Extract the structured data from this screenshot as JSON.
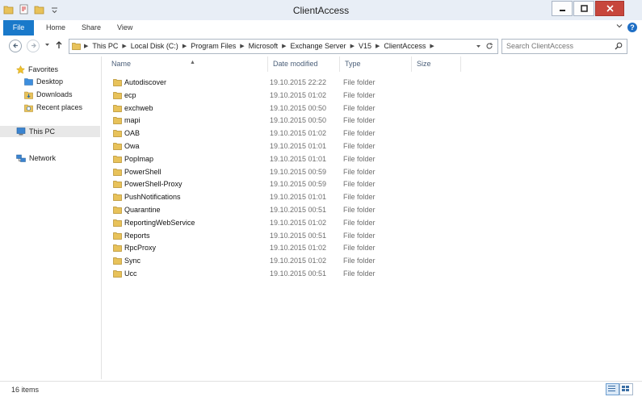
{
  "window": {
    "title": "ClientAccess"
  },
  "ribbon": {
    "tabs": [
      "File",
      "Home",
      "Share",
      "View"
    ],
    "help": "?"
  },
  "address": {
    "crumbs": [
      "This PC",
      "Local Disk (C:)",
      "Program Files",
      "Microsoft",
      "Exchange Server",
      "V15",
      "ClientAccess"
    ],
    "search_placeholder": "Search ClientAccess"
  },
  "nav": {
    "favorites": "Favorites",
    "desktop": "Desktop",
    "downloads": "Downloads",
    "recent": "Recent places",
    "thispc": "This PC",
    "network": "Network"
  },
  "columns": {
    "name": "Name",
    "date": "Date modified",
    "type": "Type",
    "size": "Size"
  },
  "files": [
    {
      "name": "Autodiscover",
      "date": "19.10.2015 22:22",
      "type": "File folder"
    },
    {
      "name": "ecp",
      "date": "19.10.2015 01:02",
      "type": "File folder"
    },
    {
      "name": "exchweb",
      "date": "19.10.2015 00:50",
      "type": "File folder"
    },
    {
      "name": "mapi",
      "date": "19.10.2015 00:50",
      "type": "File folder"
    },
    {
      "name": "OAB",
      "date": "19.10.2015 01:02",
      "type": "File folder"
    },
    {
      "name": "Owa",
      "date": "19.10.2015 01:01",
      "type": "File folder"
    },
    {
      "name": "PopImap",
      "date": "19.10.2015 01:01",
      "type": "File folder"
    },
    {
      "name": "PowerShell",
      "date": "19.10.2015 00:59",
      "type": "File folder"
    },
    {
      "name": "PowerShell-Proxy",
      "date": "19.10.2015 00:59",
      "type": "File folder"
    },
    {
      "name": "PushNotifications",
      "date": "19.10.2015 01:01",
      "type": "File folder"
    },
    {
      "name": "Quarantine",
      "date": "19.10.2015 00:51",
      "type": "File folder"
    },
    {
      "name": "ReportingWebService",
      "date": "19.10.2015 01:02",
      "type": "File folder"
    },
    {
      "name": "Reports",
      "date": "19.10.2015 00:51",
      "type": "File folder"
    },
    {
      "name": "RpcProxy",
      "date": "19.10.2015 01:02",
      "type": "File folder"
    },
    {
      "name": "Sync",
      "date": "19.10.2015 01:02",
      "type": "File folder"
    },
    {
      "name": "Ucc",
      "date": "19.10.2015 00:51",
      "type": "File folder"
    }
  ],
  "status": {
    "items": "16 items"
  },
  "colors": {
    "accent": "#1979ca",
    "folder": "#e8c25a",
    "close": "#c7463c"
  }
}
